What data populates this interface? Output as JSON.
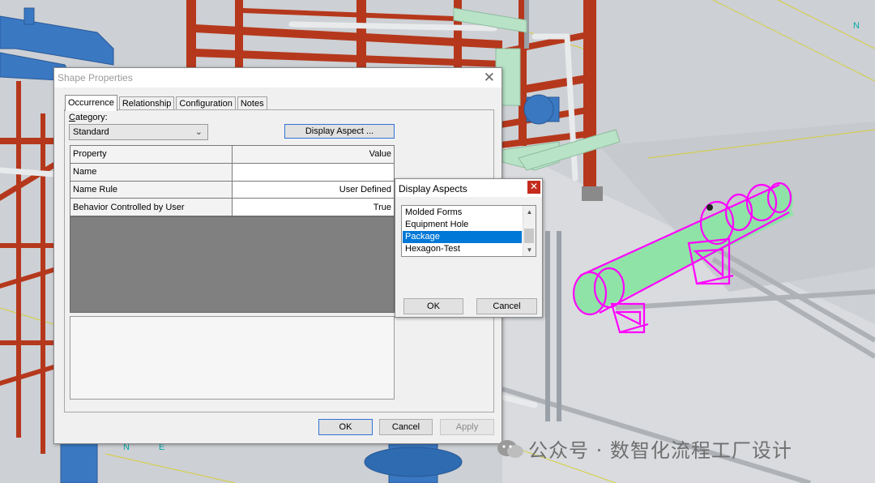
{
  "viewport": {
    "compass_top_right": "N",
    "compass_bottom_n": "N",
    "compass_bottom_e": "E",
    "highlight_color": "#ff00ff",
    "steel_color": "#b5381c",
    "equipment_color": "#8fe3a6",
    "vessel_color": "#3a78c2"
  },
  "shape_properties": {
    "title": "Shape Properties",
    "close_glyph": "✕",
    "tabs": [
      {
        "label": "Occurrence",
        "active": true
      },
      {
        "label": "Relationship",
        "active": false
      },
      {
        "label": "Configuration",
        "active": false
      },
      {
        "label": "Notes",
        "active": false
      }
    ],
    "category_label_accel": "C",
    "category_label_rest": "ategory:",
    "category_value": "Standard",
    "display_aspect_button": "Display Aspect ...",
    "grid": {
      "header": [
        "Property",
        "Value"
      ],
      "rows": [
        {
          "property": "Name",
          "value": ""
        },
        {
          "property": "Name Rule",
          "value": "User Defined"
        },
        {
          "property": "Behavior Controlled by User",
          "value": "True"
        }
      ]
    },
    "buttons": {
      "ok": "OK",
      "cancel": "Cancel",
      "apply": "Apply"
    }
  },
  "display_aspects": {
    "title": "Display Aspects",
    "close_glyph": "✕",
    "items": [
      "Molded Forms",
      "Equipment Hole",
      "Package",
      "Hexagon-Test"
    ],
    "selected": "Package",
    "buttons": {
      "ok": "OK",
      "cancel": "Cancel"
    }
  },
  "watermark": {
    "text": "公众号 · 数智化流程工厂设计"
  }
}
